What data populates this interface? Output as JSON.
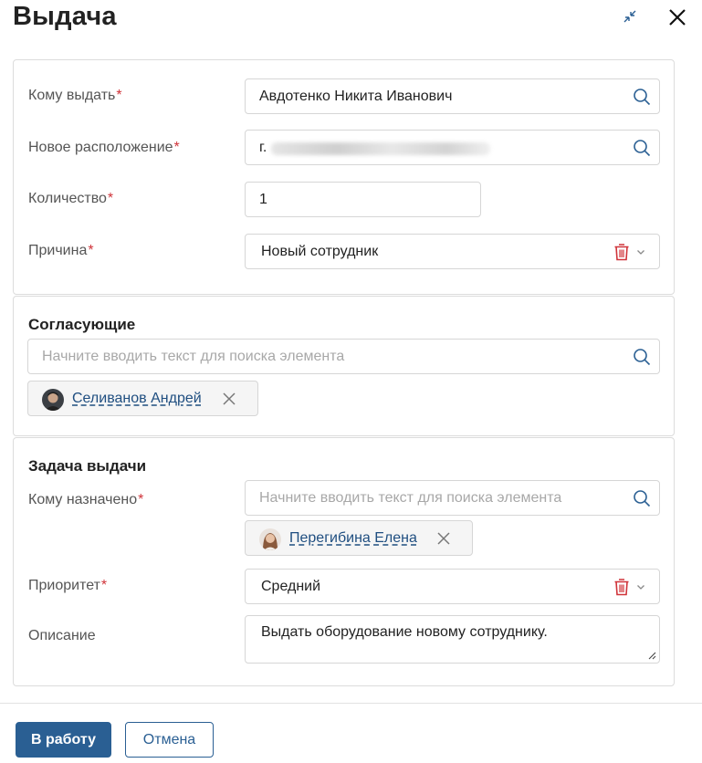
{
  "dialog": {
    "title": "Выдача",
    "required_mark": "*"
  },
  "main": {
    "recipient_label": "Кому выдать",
    "recipient_value": "Авдотенко Никита Иванович",
    "location_label": "Новое расположение",
    "location_value": "г.",
    "quantity_label": "Количество",
    "quantity_value": "1",
    "reason_label": "Причина",
    "reason_value": "Новый сотрудник"
  },
  "approvers": {
    "title": "Согласующие",
    "search_placeholder": "Начните вводить текст для поиска элемента",
    "chip_name": "Селиванов Андрей"
  },
  "task": {
    "title": "Задача выдачи",
    "assignee_label": "Кому назначено",
    "assignee_placeholder": "Начните вводить текст для поиска элемента",
    "assignee_chip": "Перегибина Елена",
    "priority_label": "Приоритет",
    "priority_value": "Средний",
    "description_label": "Описание",
    "description_value": "Выдать оборудование новому сотруднику."
  },
  "footer": {
    "submit_label": "В работу",
    "cancel_label": "Отмена"
  },
  "icons": {
    "search": "search-icon",
    "trash": "trash-icon",
    "chevron": "chevron-down-icon",
    "remove": "close-icon",
    "collapse": "collapse-icon",
    "close": "close-icon"
  },
  "colors": {
    "accent": "#2a5f93",
    "required": "#d0343a",
    "link": "#1f4e80",
    "trash": "#d0343a"
  }
}
